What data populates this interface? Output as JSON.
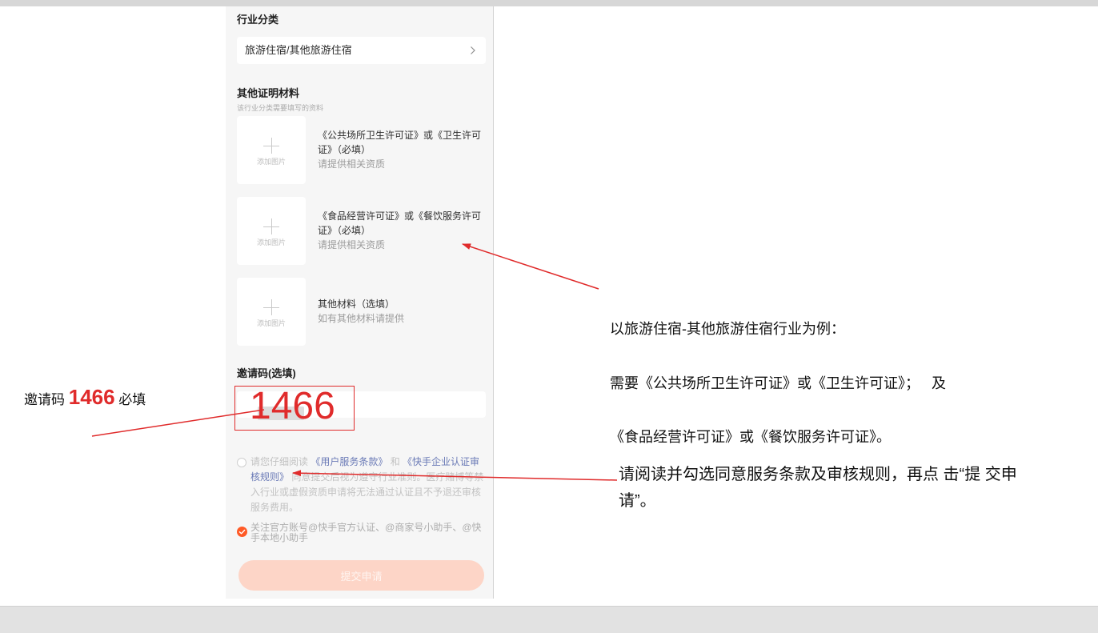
{
  "form": {
    "industry": {
      "title": "行业分类",
      "selected": "旅游住宿/其他旅游住宿",
      "icon": "chevron-right-icon"
    },
    "materials": {
      "title": "其他证明材料",
      "subtitle": "该行业分类需要填写的资料",
      "items": [
        {
          "upload_label": "添加图片",
          "upload_icon": "plus-icon",
          "title": "《公共场所卫生许可证》或《卫生许可证》（必填）",
          "hint": "请提供相关资质"
        },
        {
          "upload_label": "添加图片",
          "upload_icon": "plus-icon",
          "title": "《食品经营许可证》或《餐饮服务许可证》（必填）",
          "hint": "请提供相关资质"
        },
        {
          "upload_label": "添加图片",
          "upload_icon": "plus-icon",
          "title": "其他材料（选填）",
          "hint": "如有其他材料请提供"
        }
      ]
    },
    "invite": {
      "title": "邀请码(选填)"
    },
    "agreement": {
      "checked": false,
      "icon": "radio-unchecked-icon",
      "prefix": "请您仔细阅读 ",
      "link_terms": "《用户服务条款》",
      "joiner": " 和 ",
      "link_rules": "《快手企业认证审核规则》",
      "suffix": " 同意提交后视为遵守行业准则。医疗赌博等禁入行业或虚假资质申请将无法通过认证且不予退还审核服务费用。"
    },
    "follow": {
      "checked": true,
      "icon": "check-circle-icon",
      "text": "关注官方账号@快手官方认证、@商家号小助手、@快手本地小助手"
    },
    "submit_label": "提交申请"
  },
  "annotations": {
    "invite_note": {
      "prefix": "邀请码 ",
      "code": "1466",
      "suffix": " 必填"
    },
    "invite_overlay_code": "1466",
    "industry_example": [
      "以旅游住宿-其他旅游住宿行业为例：",
      "需要《公共场所卫生许可证》或《卫生许可证》；   及",
      "《食品经营许可证》或《餐饮服务许可证》。"
    ],
    "agreement_tip": "请阅读并勾选同意服务条款及审核规则，再点 击“提 交申请”。"
  },
  "colors": {
    "accent": "#ff5a26",
    "annotation": "#e02b2b",
    "link": "#6a7ab6",
    "submit_bg": "#fdd5c7"
  }
}
